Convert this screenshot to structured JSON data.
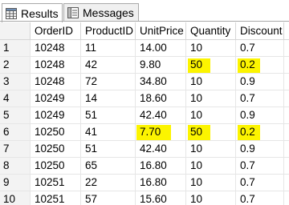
{
  "tabs": {
    "results_label": "Results",
    "messages_label": "Messages"
  },
  "colors": {
    "highlight": "#fcf400",
    "row_number_bg": "#f3f3f3"
  },
  "grid": {
    "columns": [
      "OrderID",
      "ProductID",
      "UnitPrice",
      "Quantity",
      "Discount"
    ],
    "rows": [
      {
        "num": "1",
        "OrderID": "10248",
        "ProductID": "11",
        "UnitPrice": "14.00",
        "Quantity": "10",
        "Discount": "0.7"
      },
      {
        "num": "2",
        "OrderID": "10248",
        "ProductID": "42",
        "UnitPrice": "9.80",
        "Quantity": "50",
        "Discount": "0.2"
      },
      {
        "num": "3",
        "OrderID": "10248",
        "ProductID": "72",
        "UnitPrice": "34.80",
        "Quantity": "10",
        "Discount": "0.9"
      },
      {
        "num": "4",
        "OrderID": "10249",
        "ProductID": "14",
        "UnitPrice": "18.60",
        "Quantity": "10",
        "Discount": "0.7"
      },
      {
        "num": "5",
        "OrderID": "10249",
        "ProductID": "51",
        "UnitPrice": "42.40",
        "Quantity": "10",
        "Discount": "0.9"
      },
      {
        "num": "6",
        "OrderID": "10250",
        "ProductID": "41",
        "UnitPrice": "7.70",
        "Quantity": "50",
        "Discount": "0.2"
      },
      {
        "num": "7",
        "OrderID": "10250",
        "ProductID": "51",
        "UnitPrice": "42.40",
        "Quantity": "10",
        "Discount": "0.9"
      },
      {
        "num": "8",
        "OrderID": "10250",
        "ProductID": "65",
        "UnitPrice": "16.80",
        "Quantity": "10",
        "Discount": "0.7"
      },
      {
        "num": "9",
        "OrderID": "10251",
        "ProductID": "22",
        "UnitPrice": "16.80",
        "Quantity": "10",
        "Discount": "0.7"
      },
      {
        "num": "10",
        "OrderID": "10251",
        "ProductID": "57",
        "UnitPrice": "15.60",
        "Quantity": "10",
        "Discount": "0.7"
      }
    ]
  }
}
